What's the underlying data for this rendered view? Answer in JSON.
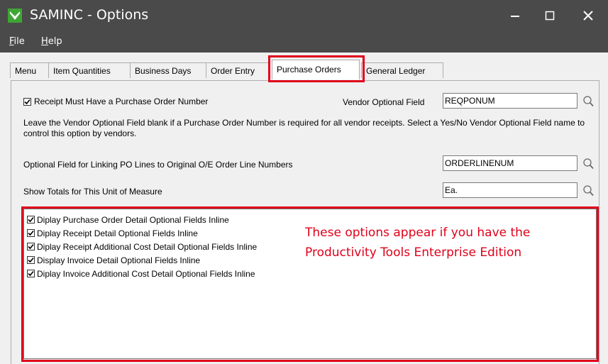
{
  "window": {
    "title": "SAMINC - Options"
  },
  "colors": {
    "titlebar": "#4a4a4a",
    "highlight": "#e0001a",
    "accent_icon": "#3fa535"
  },
  "menu": {
    "file": "File",
    "file_key": "F",
    "file_rest": "ile",
    "help": "Help",
    "help_key": "H",
    "help_rest": "elp"
  },
  "tabs": [
    {
      "label": "Menu"
    },
    {
      "label": "Item Quantities"
    },
    {
      "label": "Business Days"
    },
    {
      "label": "Order Entry"
    },
    {
      "label": "Purchase Orders",
      "active": true
    },
    {
      "label": "General Ledger"
    }
  ],
  "options": {
    "receipt_po_label": "Receipt Must Have a Purchase Order Number",
    "receipt_po_checked": true,
    "vendor_field_label": "Vendor Optional Field",
    "vendor_field_value": "REQPONUM",
    "description": "Leave the Vendor Optional Field blank if a Purchase Order Number is required for all vendor receipts. Select a Yes/No Vendor Optional Field name to control this option by vendors.",
    "linking_label": "Optional Field for Linking PO Lines to Original O/E Order Line Numbers",
    "linking_value": "ORDERLINENUM",
    "uom_label": "Show Totals for This Unit of Measure",
    "uom_value": "Ea."
  },
  "inline_options": [
    {
      "label": "Diplay Purchase Order Detail Optional Fields Inline",
      "checked": true
    },
    {
      "label": "Diplay Receipt Detail Optional Fields Inline",
      "checked": true
    },
    {
      "label": "Diplay Receipt Additional Cost Detail Optional Fields Inline",
      "checked": true
    },
    {
      "label": "Display Invoice Detail Optional Fields Inline",
      "checked": true
    },
    {
      "label": "Diplay Invoice Additional Cost Detail Optional Fields Inline",
      "checked": true
    }
  ],
  "annotation": {
    "line1": "These options appear if you have the",
    "line2": "Productivity Tools Enterprise Edition"
  }
}
